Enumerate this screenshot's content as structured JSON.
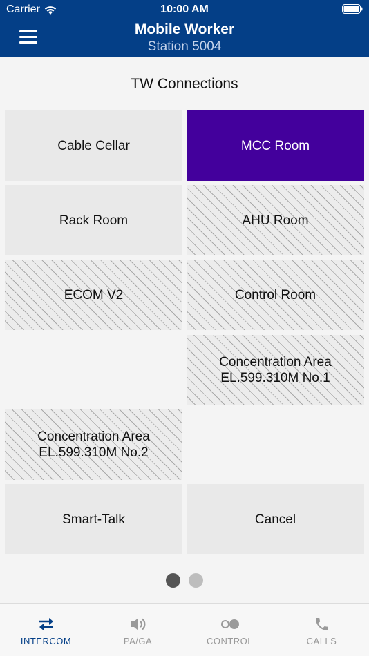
{
  "status_bar": {
    "carrier": "Carrier",
    "time": "10:00 AM"
  },
  "header": {
    "title": "Mobile Worker",
    "subtitle": "Station 5004"
  },
  "section": {
    "title": "TW Connections"
  },
  "tiles": [
    {
      "label": "Cable Cellar",
      "state": "available"
    },
    {
      "label": "MCC Room",
      "state": "selected"
    },
    {
      "label": "Rack Room",
      "state": "available"
    },
    {
      "label": "AHU Room",
      "state": "unavailable"
    },
    {
      "label": "ECOM V2",
      "state": "unavailable"
    },
    {
      "label": "Control Room",
      "state": "unavailable"
    },
    {
      "label": "Concentration Area EL.599.310M No.1",
      "state": "unavailable"
    },
    {
      "label": "Concentration Area EL.599.310M No.2",
      "state": "unavailable"
    },
    {
      "label": "Smart-Talk",
      "state": "available"
    },
    {
      "label": "Cancel",
      "state": "available"
    }
  ],
  "pager": {
    "pages": 2,
    "current": 1
  },
  "tabs": [
    {
      "label": "INTERCOM",
      "icon": "swap-arrows-icon",
      "selected": true
    },
    {
      "label": "PA/GA",
      "icon": "speaker-icon",
      "selected": false
    },
    {
      "label": "CONTROL",
      "icon": "toggle-icon",
      "selected": false
    },
    {
      "label": "CALLS",
      "icon": "phone-icon",
      "selected": false
    }
  ],
  "colors": {
    "header": "#043f87",
    "selected_tile": "#43009c",
    "tab_active": "#043f87",
    "tab_inactive": "#9a9a9a"
  }
}
